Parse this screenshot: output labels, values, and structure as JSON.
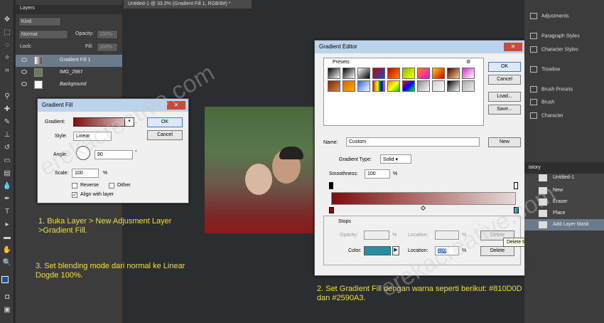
{
  "document_tab": "Untitled-1 @ 33.3% (Gradient Fill 1, RGB/8#) *",
  "layers_panel": {
    "tab": "Layers",
    "kind": "Kind",
    "blend_mode": "Normal",
    "opacity_label": "Opacity:",
    "opacity_value": "100%",
    "lock_label": "Lock:",
    "fill_label": "Fill:",
    "fill_value": "100%",
    "layers": [
      {
        "name": "Gradient Fill 1"
      },
      {
        "name": "IMG_2987"
      },
      {
        "name": "Background"
      }
    ]
  },
  "gradient_fill_dialog": {
    "title": "Gradient Fill",
    "gradient_label": "Gradient:",
    "style_label": "Style:",
    "style_value": "Linear",
    "angle_label": "Angle:",
    "angle_value": "90",
    "angle_unit": "°",
    "scale_label": "Scale:",
    "scale_value": "100",
    "scale_unit": "%",
    "reverse": "Reverse",
    "dither": "Dither",
    "align": "Align with layer",
    "ok": "OK",
    "cancel": "Cancel"
  },
  "gradient_editor": {
    "title": "Gradient Editor",
    "presets_label": "Presets",
    "ok": "OK",
    "cancel": "Cancel",
    "load": "Load...",
    "save": "Save...",
    "name_label": "Name:",
    "name_value": "Custom",
    "new": "New",
    "gradient_type_label": "Gradient Type:",
    "gradient_type_value": "Solid",
    "smoothness_label": "Smoothness:",
    "smoothness_value": "100",
    "smoothness_unit": "%",
    "stops_label": "Stops",
    "opacity_label": "Opacity:",
    "opacity_unit": "%",
    "location_label": "Location:",
    "location_unit": "%",
    "delete": "Delete",
    "color_label": "Color:",
    "location2_value": "100",
    "tooltip": "Delete the selected opacity stop",
    "color1": "#810D0D",
    "color2": "#2590A3"
  },
  "right_panel": {
    "items": [
      "Adjustments",
      "Paragraph Styles",
      "Character Styles",
      "Timeline",
      "Brush Presets",
      "Brush",
      "Character"
    ]
  },
  "history_panel": {
    "tab": "istory",
    "items": [
      "Untitled-1",
      "New",
      "Eraser",
      "Place",
      "Add Layer Mask"
    ]
  },
  "notes": {
    "note1": "1. Buka Layer > New Adjusment Layer >Gradient Fill.",
    "note2": "2. Set Gradient Fill dengan warna seperti berikut: #810D0D dan #2590A3.",
    "note3": "3. Set blending mode dari normal ke Linear Dogde 100%."
  },
  "watermark": "erekacreative.com"
}
